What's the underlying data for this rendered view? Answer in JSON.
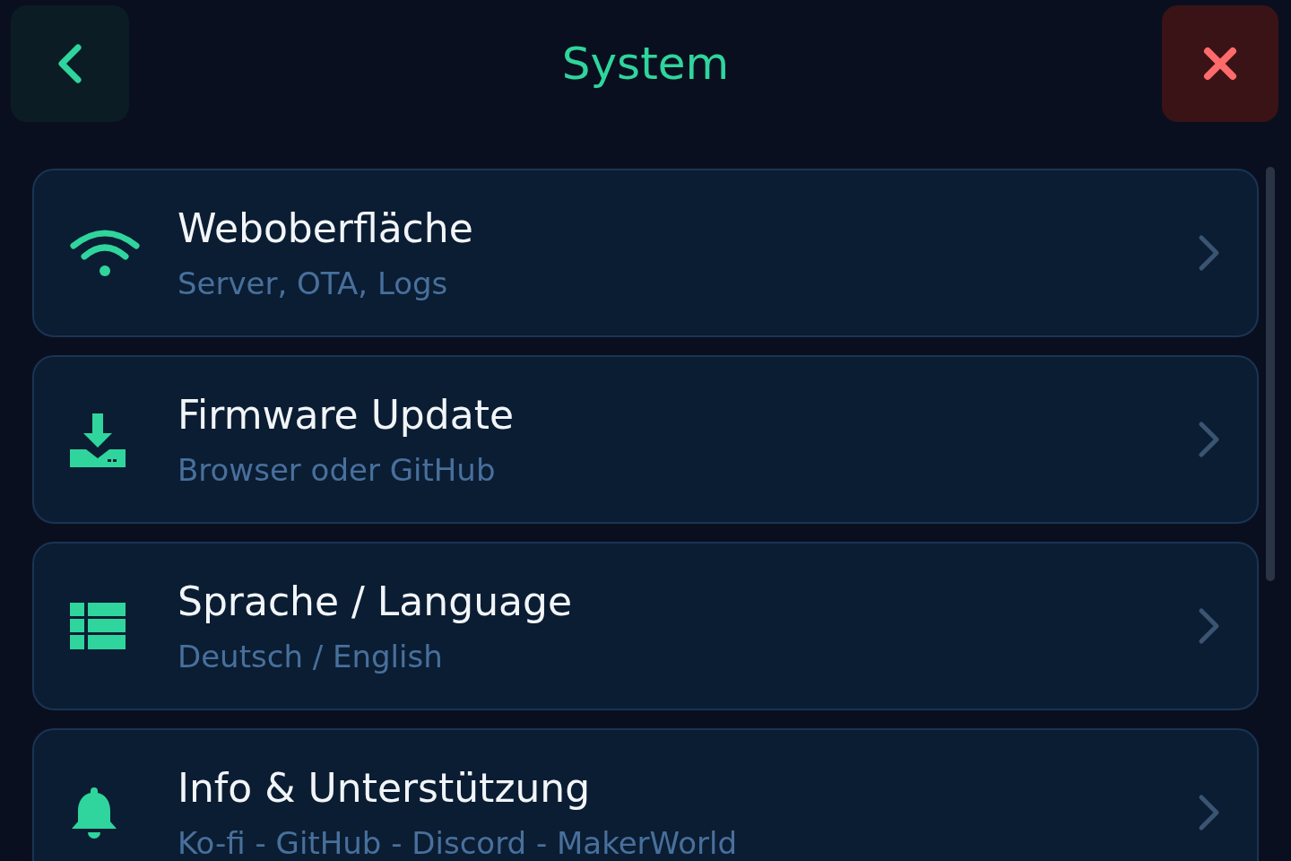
{
  "header": {
    "title": "System"
  },
  "items": [
    {
      "kind": "wifi",
      "title": "Weboberfläche",
      "subtitle": "Server, OTA, Logs"
    },
    {
      "kind": "download",
      "title": "Firmware Update",
      "subtitle": "Browser oder GitHub"
    },
    {
      "kind": "table",
      "title": "Sprache / Language",
      "subtitle": "Deutsch / English"
    },
    {
      "kind": "bell",
      "title": "Info & Unterstützung",
      "subtitle": "Ko-fi - GitHub - Discord - MakerWorld"
    }
  ]
}
